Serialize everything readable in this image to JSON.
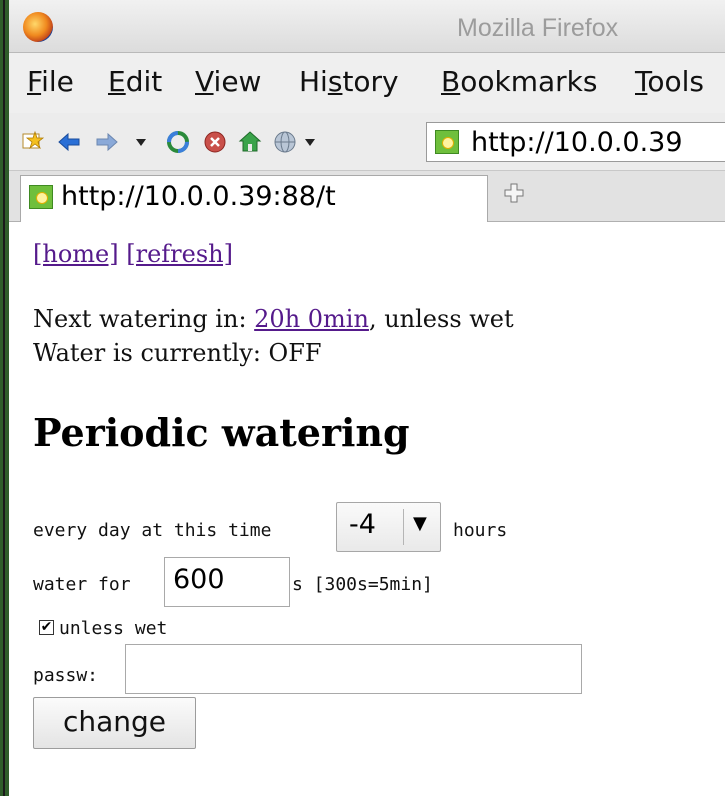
{
  "window": {
    "title": "Mozilla Firefox"
  },
  "menu": [
    {
      "prefix": "",
      "underlined": "F",
      "suffix": "ile"
    },
    {
      "prefix": "",
      "underlined": "E",
      "suffix": "dit"
    },
    {
      "prefix": "",
      "underlined": "V",
      "suffix": "iew"
    },
    {
      "prefix": "Hi",
      "underlined": "s",
      "suffix": "tory"
    },
    {
      "prefix": "",
      "underlined": "B",
      "suffix": "ookmarks"
    },
    {
      "prefix": "",
      "underlined": "T",
      "suffix": "ools"
    }
  ],
  "toolbar": {
    "icons": [
      "bookmark-star-icon",
      "back-arrow-icon",
      "forward-arrow-icon",
      "history-dropdown-icon",
      "reload-icon",
      "stop-icon",
      "home-icon",
      "globe-icon"
    ],
    "url": "http://10.0.0.39"
  },
  "tabs": [
    {
      "label": "http://10.0.0.39:88/t"
    }
  ],
  "page": {
    "links": {
      "home": "[home]",
      "refresh": "[refresh]"
    },
    "next_watering_label": "Next watering in: ",
    "next_watering_value": "20h 0min",
    "next_watering_suffix": ", unless wet",
    "water_status": "Water is currently: OFF",
    "heading": "Periodic watering",
    "form": {
      "every_day_label": "every day at this time",
      "hours_selected": "-4",
      "hours_unit": "hours",
      "water_for_label": "water for",
      "duration_value": "600",
      "duration_unit": "s [300s=5min]",
      "unless_wet_label": "unless wet",
      "unless_wet_checked": true,
      "password_label": "passw:",
      "password_value": "",
      "submit_label": "change"
    }
  }
}
